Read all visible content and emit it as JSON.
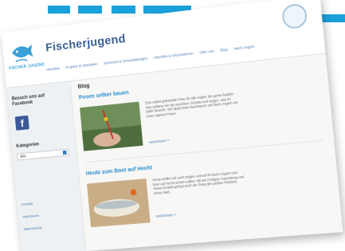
{
  "site": {
    "title": "Fischerjugend"
  },
  "nav": {
    "items": [
      "Aktuelles",
      "Projekte & Aktivitäten",
      "Seminare & Veranstaltungen",
      "Aktuelles & Informationen",
      "Über uns",
      "Blog",
      "Nach Angeln"
    ]
  },
  "sidebar": {
    "facebook_heading": "Besuch uns auf Facebook",
    "categories_heading": "Kategorien",
    "category_selected": "Alle",
    "links": [
      "Kontakt",
      "Impressum",
      "Datenschutz"
    ]
  },
  "main": {
    "blog_heading": "Blog",
    "posts": [
      {
        "title": "Posen selber bauen",
        "excerpt": "Eine selbst gebastelte Pose für alle Angler, die gerne basteln. Hier erklären wir die einzelnen Schritte und zeigen, was ihr dafür braucht. Viel Spaß beim Nachbauen und beim Angeln mit eurer eigenen Pose!",
        "read_more": "weiterlesen »"
      },
      {
        "title": "Heute zum Boot auf Hecht",
        "excerpt": "Heute wollen wir euch zeigen, worauf ihr beim Angeln vom Boot auf Hecht achten solltet. Mit der richtigen Ausrüstung und etwas Geduld gelingt euch der Fang des großen Räubers sicher bald.",
        "read_more": "weiterlesen »"
      }
    ]
  },
  "colors": {
    "accent_blue": "#1aa1dc",
    "title_blue": "#3a5f96",
    "link_blue": "#2e8fd0",
    "facebook_blue": "#3b5998"
  }
}
